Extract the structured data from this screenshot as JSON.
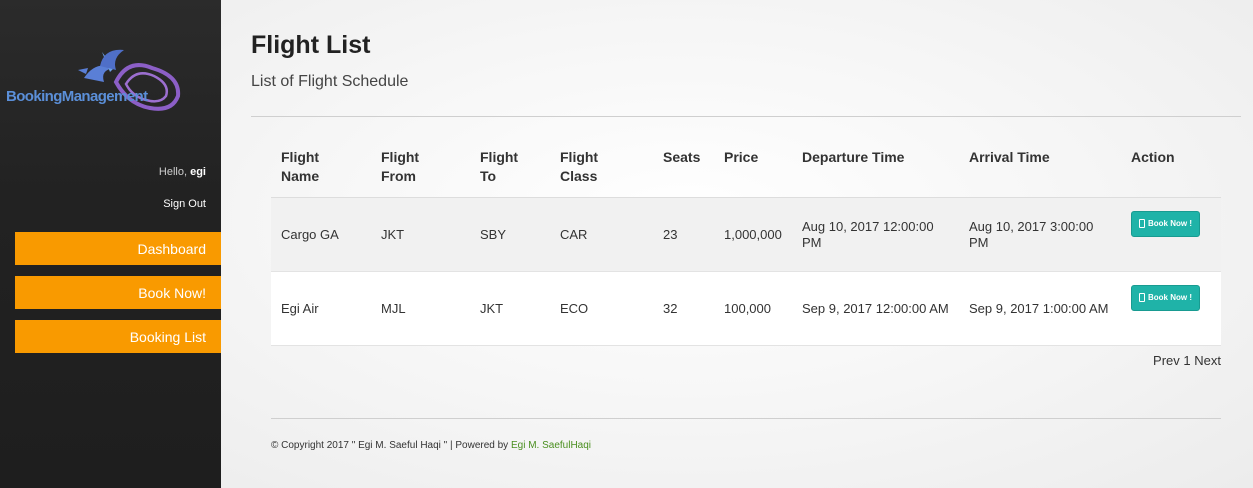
{
  "brand": {
    "logo_text": "BookingManagement"
  },
  "user": {
    "greeting": "Hello,",
    "name": "egi",
    "signout_label": "Sign Out"
  },
  "nav": [
    {
      "label": "Dashboard"
    },
    {
      "label": "Book Now!"
    },
    {
      "label": "Booking List"
    }
  ],
  "page": {
    "title": "Flight List",
    "subtitle": "List of Flight Schedule"
  },
  "table": {
    "headers": [
      "Flight\nName",
      "Flight\nFrom",
      "Flight\nTo",
      "Flight\nClass",
      "Seats",
      "Price",
      "Departure Time",
      "Arrival Time",
      "Action"
    ],
    "rows": [
      {
        "name": "Cargo GA",
        "from": "JKT",
        "to": "SBY",
        "class": "CAR",
        "seats": "23",
        "price": "1,000,000",
        "departure": "Aug 10, 2017 12:00:00 PM",
        "arrival": "Aug 10, 2017 3:00:00 PM",
        "action_label": "Book Now !"
      },
      {
        "name": "Egi Air",
        "from": "MJL",
        "to": "JKT",
        "class": "ECO",
        "seats": "32",
        "price": "100,000",
        "departure": "Sep 9, 2017 12:00:00 AM",
        "arrival": "Sep 9, 2017 1:00:00 AM",
        "action_label": "Book Now !"
      }
    ]
  },
  "pagination": {
    "prev": "Prev",
    "page": "1",
    "next": "Next"
  },
  "footer": {
    "copyright": "© Copyright 2017 \" Egi M. Saeful Haqi \" | Powered by",
    "author_link": "Egi M. SaefulHaqi"
  },
  "colors": {
    "accent": "#f99a00",
    "book_button": "#1fb3a8",
    "link": "#4a8f1f"
  }
}
